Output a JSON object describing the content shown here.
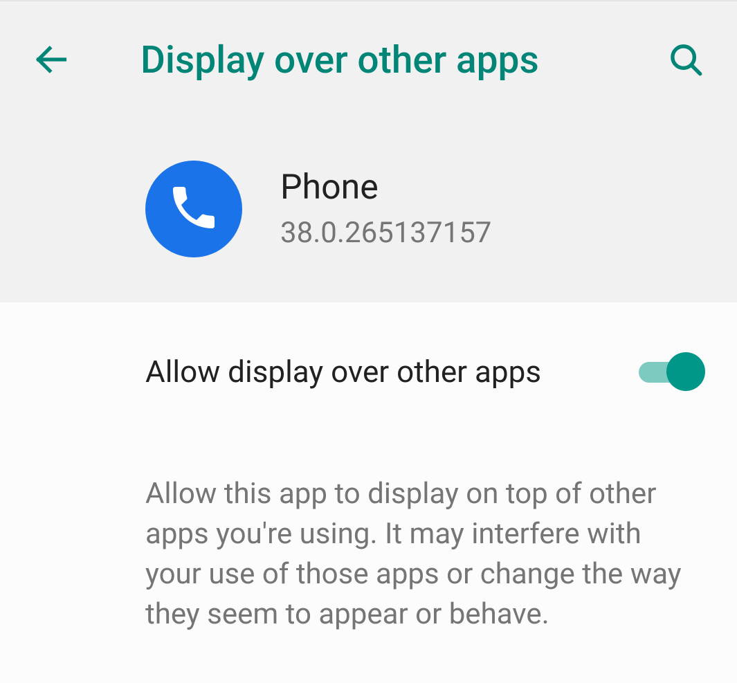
{
  "header": {
    "title": "Display over other apps"
  },
  "app": {
    "name": "Phone",
    "version": "38.0.265137157"
  },
  "setting": {
    "toggle_label": "Allow display over other apps",
    "toggle_on": true,
    "description": "Allow this app to display on top of other apps you're using. It may interfere with your use of those apps or change the way they seem to appear or behave."
  },
  "colors": {
    "accent": "#008577",
    "toggle_thumb": "#009688",
    "toggle_track": "#7ccac0",
    "app_icon_bg": "#1a73e8"
  }
}
